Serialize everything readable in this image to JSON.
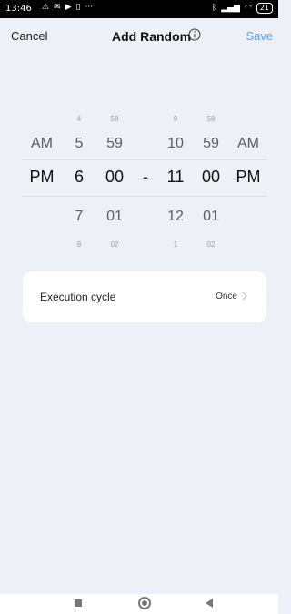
{
  "status_bar": {
    "time": "13:46",
    "left_icons": [
      "alert-icon",
      "message-icon",
      "play-icon",
      "sim-icon",
      "more-icon"
    ],
    "more_text": "···",
    "right_icons": [
      "bluetooth-icon",
      "signal-icon",
      "wifi-icon"
    ],
    "battery": "21"
  },
  "header": {
    "cancel_label": "Cancel",
    "title": "Add Random",
    "save_label": "Save",
    "save_color": "#5aa0ec"
  },
  "picker": {
    "start": {
      "period": {
        "above": "AM",
        "selected": "PM",
        "below": ""
      },
      "hour": {
        "far_above": "4",
        "above": "5",
        "selected": "6",
        "below": "7",
        "far_below": "8"
      },
      "minute": {
        "far_above": "58",
        "above": "59",
        "selected": "00",
        "below": "01",
        "far_below": "02"
      }
    },
    "separator": "-",
    "end": {
      "hour": {
        "far_above": "9",
        "above": "10",
        "selected": "11",
        "below": "12",
        "far_below": "1"
      },
      "minute": {
        "far_above": "58",
        "above": "59",
        "selected": "00",
        "below": "01",
        "far_below": "02"
      },
      "period": {
        "above": "AM",
        "selected": "PM",
        "below": ""
      }
    }
  },
  "execution_cycle": {
    "label": "Execution cycle",
    "value": "Once"
  }
}
